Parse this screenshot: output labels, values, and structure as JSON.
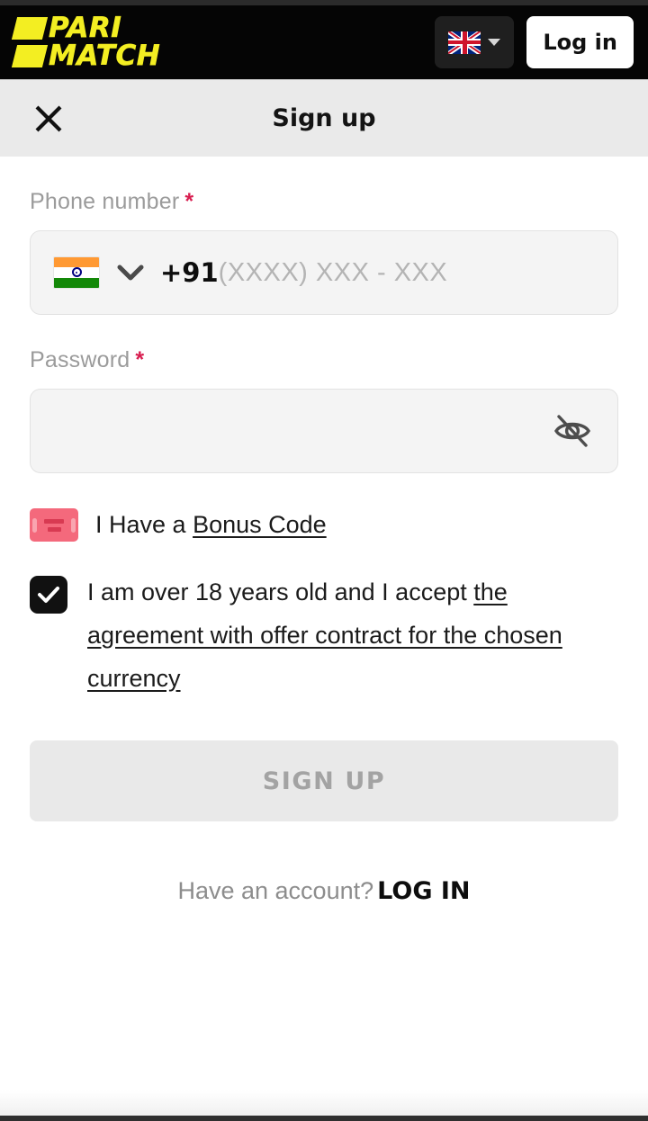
{
  "header": {
    "logo_line1": "PARI",
    "logo_line2": "MATCH",
    "language_icon": "uk-flag-icon",
    "language_caret_icon": "caret-down-icon",
    "login_label": "Log in"
  },
  "modal": {
    "close_icon": "close-icon",
    "title": "Sign up"
  },
  "form": {
    "phone": {
      "label": "Phone number",
      "required_mark": "*",
      "country_flag_icon": "india-flag-icon",
      "country_caret_icon": "chevron-down-icon",
      "dial_code": "+91",
      "placeholder": "(XXXX) XXX - XXX",
      "value": ""
    },
    "password": {
      "label": "Password",
      "required_mark": "*",
      "value": "",
      "placeholder": "",
      "toggle_icon": "eye-off-icon"
    },
    "bonus": {
      "icon": "ticket-icon",
      "prefix": "I Have a ",
      "link_label": "Bonus Code"
    },
    "terms": {
      "checkbox_icon": "checkmark-icon",
      "checked": true,
      "prefix": "I am over 18 years old and I accept ",
      "link_label": "the agreement with offer contract for the chosen currency"
    },
    "submit_label": "SIGN UP",
    "submit_disabled": true,
    "footer_prompt": "Have an account?",
    "footer_login_label": "LOG IN"
  },
  "colors": {
    "brand_yellow": "#F3EE22",
    "header_black": "#050505",
    "required_red": "#D81E50",
    "ticket_pink": "#F4697C",
    "input_bg": "#F4F4F4",
    "disabled_button_bg": "#E9E9E9",
    "disabled_button_text": "#A3A3A3"
  }
}
